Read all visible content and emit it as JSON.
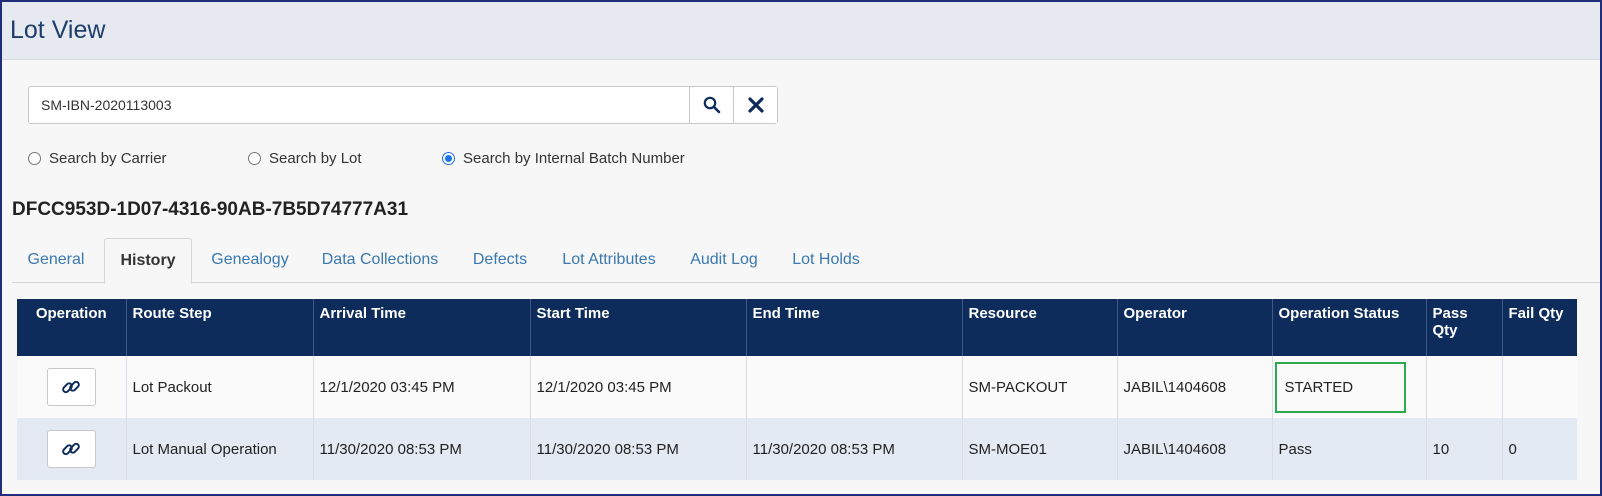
{
  "app": {
    "title": "Lot View"
  },
  "search": {
    "value": "SM-IBN-2020113003",
    "options": [
      {
        "label": "Search by Carrier",
        "checked": false
      },
      {
        "label": "Search by Lot",
        "checked": false
      },
      {
        "label": "Search by Internal Batch Number",
        "checked": true
      }
    ]
  },
  "lot": {
    "id": "DFCC953D-1D07-4316-90AB-7B5D74777A31"
  },
  "tabs": [
    "General",
    "History",
    "Genealogy",
    "Data Collections",
    "Defects",
    "Lot Attributes",
    "Audit Log",
    "Lot Holds"
  ],
  "active_tab": "History",
  "table": {
    "headers": [
      "Operation",
      "Route Step",
      "Arrival Time",
      "Start Time",
      "End Time",
      "Resource",
      "Operator",
      "Operation Status",
      "Pass Qty",
      "Fail Qty"
    ],
    "rows": [
      {
        "route_step": "Lot Packout",
        "arrival": "12/1/2020 03:45 PM",
        "start": "12/1/2020 03:45 PM",
        "end": "",
        "resource": "SM-PACKOUT",
        "operator": "JABIL\\1404608",
        "status": "STARTED",
        "pass_qty": "",
        "fail_qty": ""
      },
      {
        "route_step": "Lot Manual Operation",
        "arrival": "11/30/2020 08:53 PM",
        "start": "11/30/2020 08:53 PM",
        "end": "11/30/2020 08:53 PM",
        "resource": "SM-MOE01",
        "operator": "JABIL\\1404608",
        "status": "Pass",
        "pass_qty": "10",
        "fail_qty": "0"
      }
    ]
  },
  "icons": {
    "search": "search-icon",
    "clear": "close-icon",
    "row_link": "link-icon"
  },
  "colors": {
    "header_bg": "#0d2c5c",
    "link": "#3a78b0",
    "highlight": "#2eaa4e",
    "radio": "#1a73e8"
  }
}
